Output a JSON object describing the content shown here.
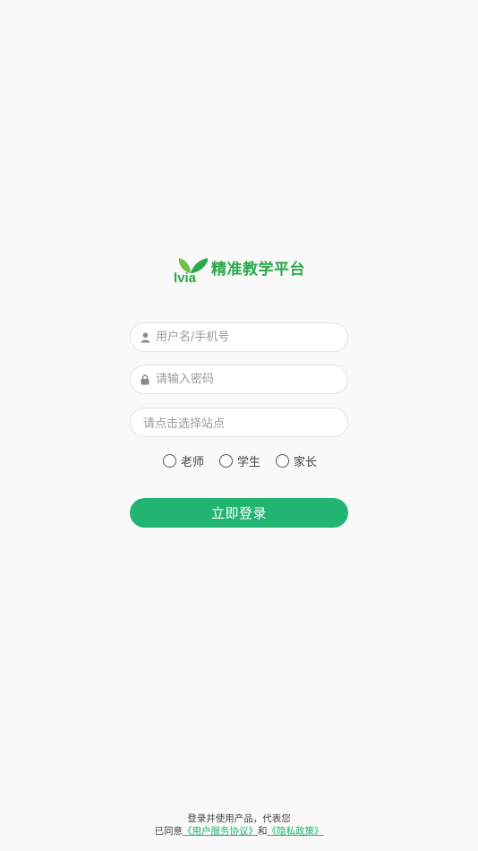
{
  "brand": {
    "logo_text": "lvia",
    "title": "精准教学平台",
    "accent_color": "#2aa84a"
  },
  "form": {
    "username_placeholder": "用户名/手机号",
    "password_placeholder": "请输入密码",
    "site_placeholder": "请点击选择站点",
    "roles": [
      {
        "label": "老师",
        "selected": false
      },
      {
        "label": "学生",
        "selected": false
      },
      {
        "label": "家长",
        "selected": false
      }
    ],
    "submit_label": "立即登录",
    "submit_color": "#22b572",
    "username_icon": "user-icon",
    "password_icon": "lock-icon"
  },
  "footer": {
    "line1": "登录并使用产品，代表您",
    "prefix": "已同意",
    "agreement_link": "《用户服务协议》",
    "conjunction": "和",
    "privacy_link": "《隐私政策》"
  }
}
